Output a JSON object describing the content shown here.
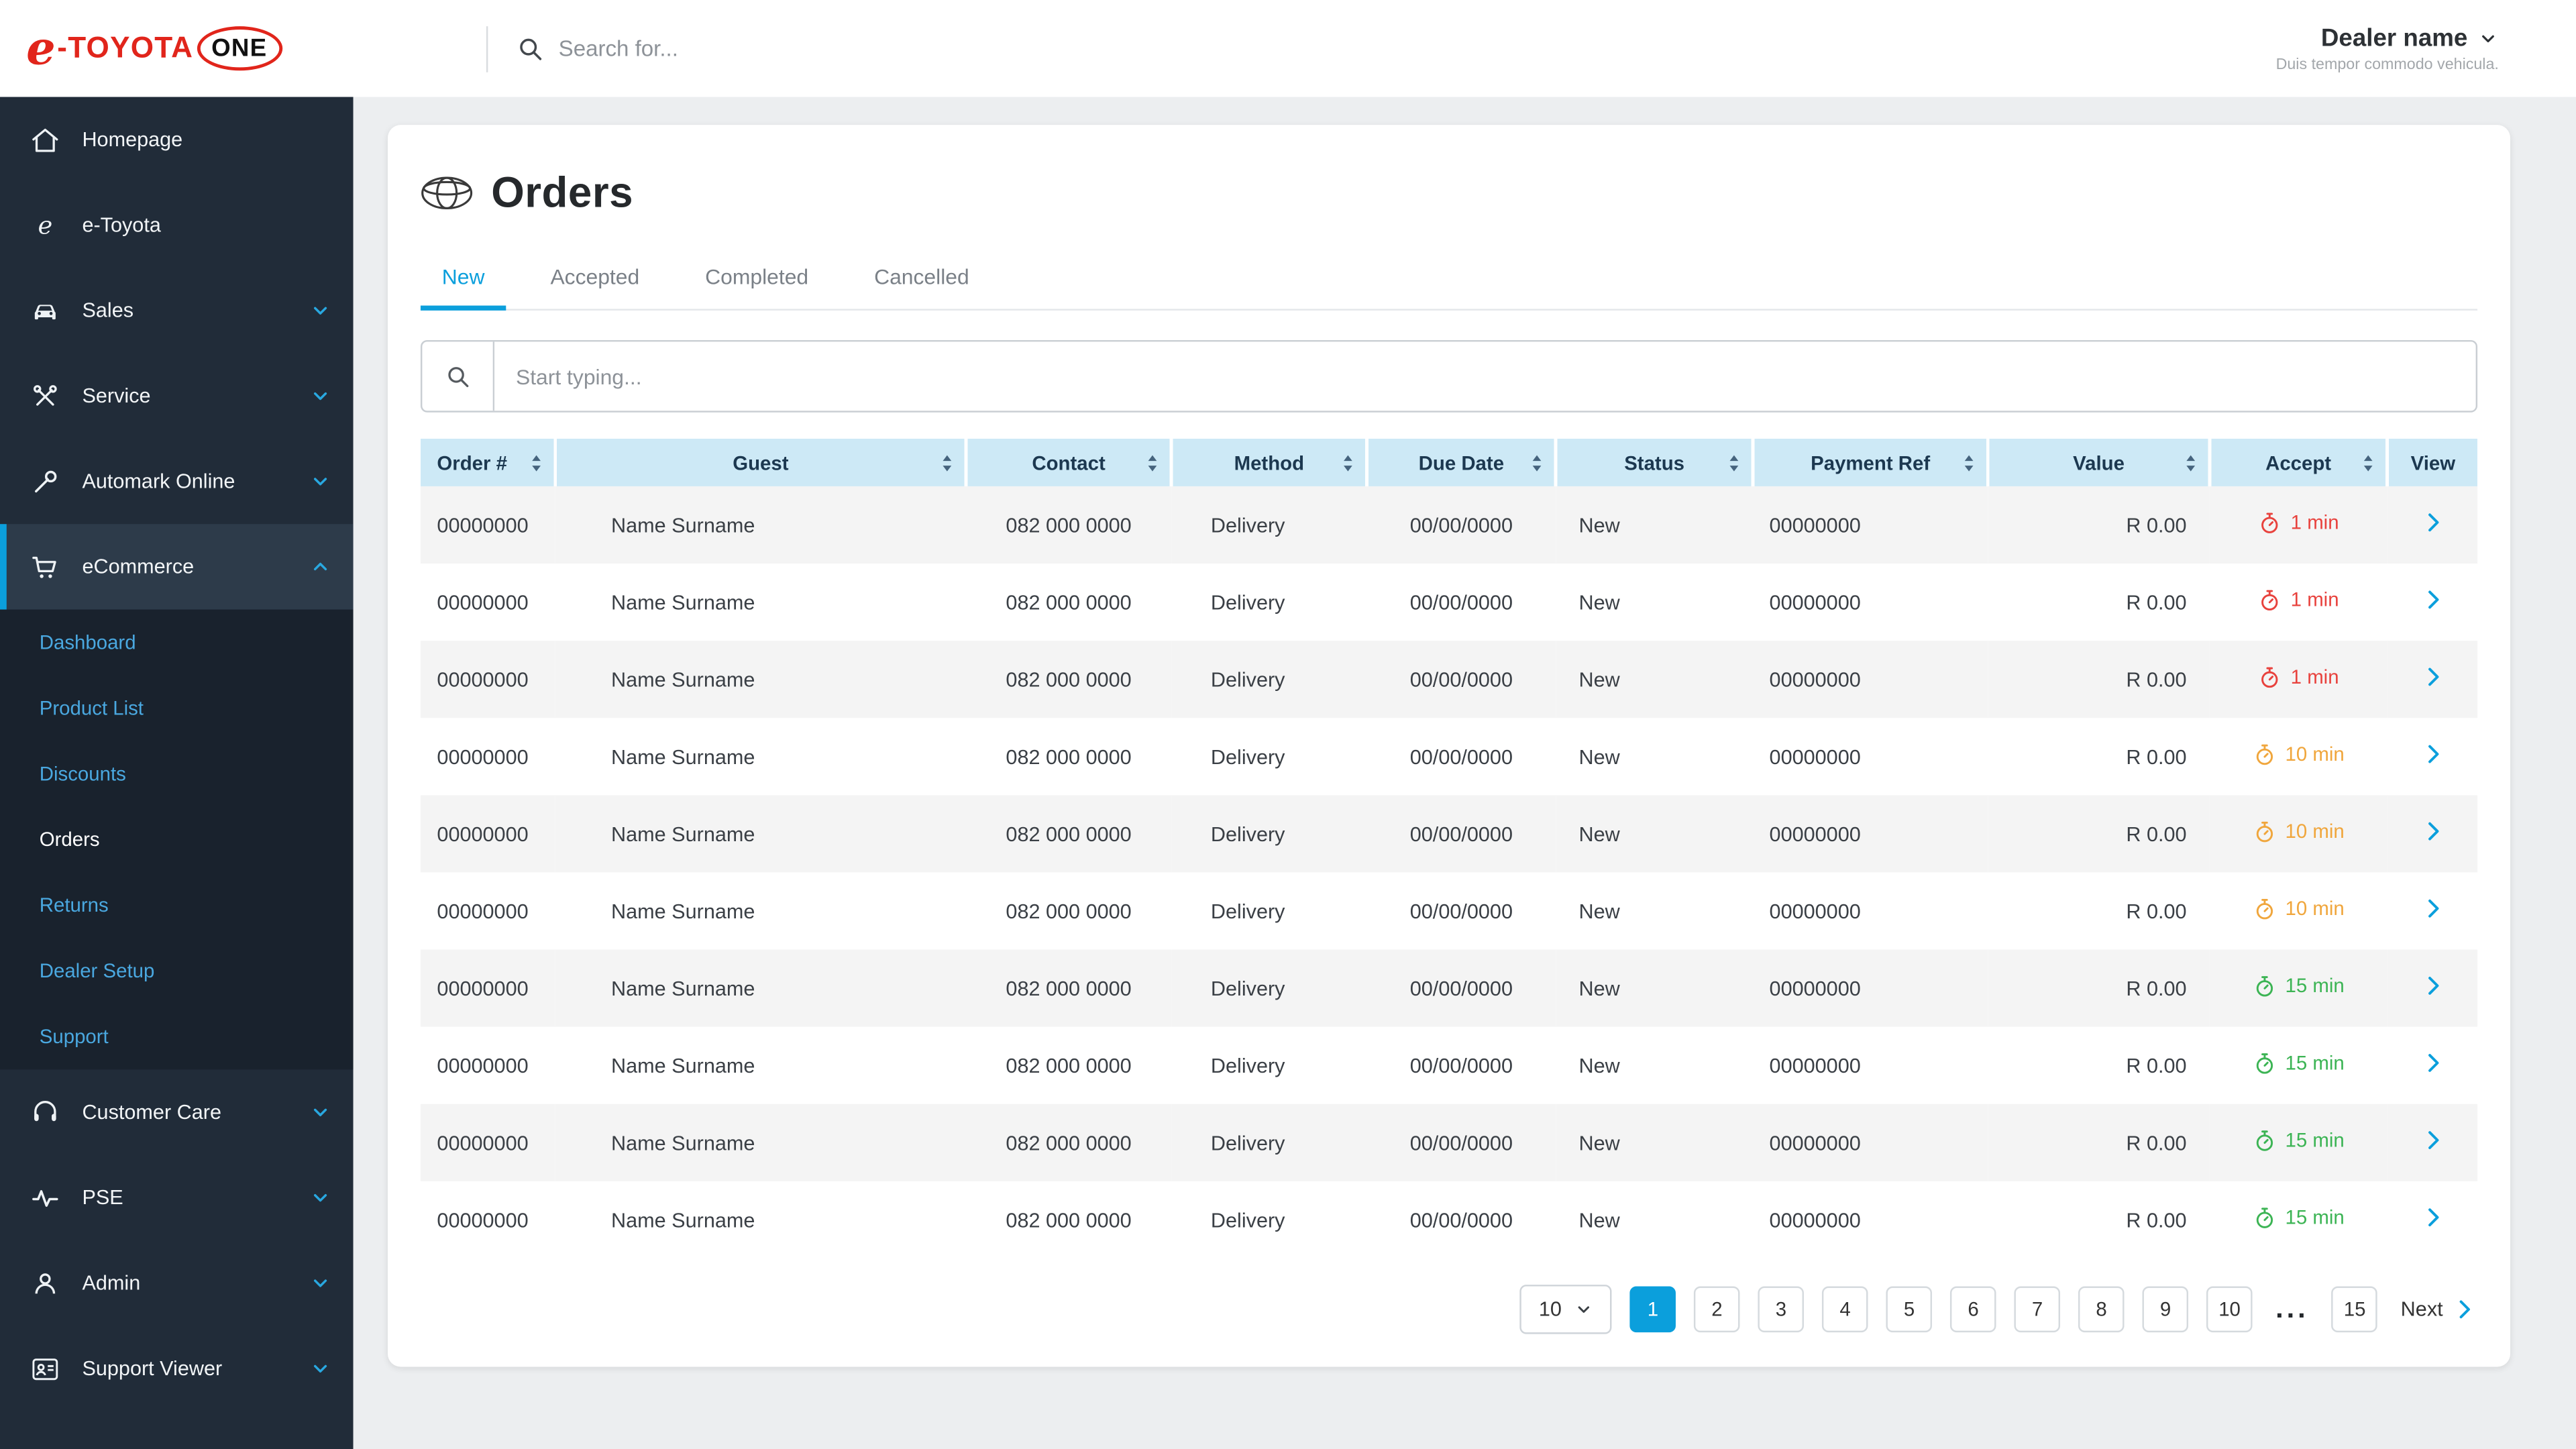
{
  "topbar": {
    "logo": {
      "e": "e",
      "brand": "-TOYOTA",
      "one": "ONE"
    },
    "search": {
      "placeholder": "Search for...",
      "icon": "search-icon"
    },
    "dealer": {
      "name": "Dealer name",
      "subtitle": "Duis tempor commodo vehicula.",
      "icon": "chevron-down-icon"
    }
  },
  "sidebar": {
    "items": [
      {
        "label": "Homepage",
        "icon": "home-icon",
        "expandable": false
      },
      {
        "label": "e-Toyota",
        "icon": "etoyota-icon",
        "expandable": false
      },
      {
        "label": "Sales",
        "icon": "car-icon",
        "expandable": true
      },
      {
        "label": "Service",
        "icon": "tools-icon",
        "expandable": true
      },
      {
        "label": "Automark Online",
        "icon": "wrench-icon",
        "expandable": true
      },
      {
        "label": "eCommerce",
        "icon": "cart-icon",
        "expandable": true,
        "expanded": true,
        "active": true,
        "children": [
          {
            "label": "Dashboard"
          },
          {
            "label": "Product List"
          },
          {
            "label": "Discounts"
          },
          {
            "label": "Orders",
            "active": true
          },
          {
            "label": "Returns"
          },
          {
            "label": "Dealer Setup"
          },
          {
            "label": "Support"
          }
        ]
      },
      {
        "label": "Customer Care",
        "icon": "headset-icon",
        "expandable": true
      },
      {
        "label": "PSE",
        "icon": "pulse-icon",
        "expandable": true
      },
      {
        "label": "Admin",
        "icon": "user-icon",
        "expandable": true
      },
      {
        "label": "Support Viewer",
        "icon": "id-card-icon",
        "expandable": true
      }
    ]
  },
  "page": {
    "title": "Orders",
    "title_icon": "toyota-emblem-icon",
    "tabs": [
      {
        "label": "New",
        "active": true
      },
      {
        "label": "Accepted",
        "active": false
      },
      {
        "label": "Completed",
        "active": false
      },
      {
        "label": "Cancelled",
        "active": false
      }
    ],
    "filter": {
      "placeholder": "Start typing...",
      "icon": "search-icon"
    }
  },
  "table": {
    "columns": [
      {
        "label": "Order #",
        "sortable": true
      },
      {
        "label": "Guest",
        "sortable": true
      },
      {
        "label": "Contact",
        "sortable": true
      },
      {
        "label": "Method",
        "sortable": true
      },
      {
        "label": "Due Date",
        "sortable": true
      },
      {
        "label": "Status",
        "sortable": true
      },
      {
        "label": "Payment Ref",
        "sortable": true
      },
      {
        "label": "Value",
        "sortable": true
      },
      {
        "label": "Accept",
        "sortable": true
      },
      {
        "label": "View",
        "sortable": false
      }
    ],
    "accept_colors": {
      "high": "#e8423d",
      "medium": "#f0a63c",
      "low": "#3cb454"
    },
    "rows": [
      {
        "order": "00000000",
        "guest": "Name Surname",
        "contact": "082 000 0000",
        "method": "Delivery",
        "due_date": "00/00/0000",
        "status": "New",
        "payment_ref": "00000000",
        "value": "R 0.00",
        "accept": {
          "label": "1 min",
          "urgency": "high"
        }
      },
      {
        "order": "00000000",
        "guest": "Name Surname",
        "contact": "082 000 0000",
        "method": "Delivery",
        "due_date": "00/00/0000",
        "status": "New",
        "payment_ref": "00000000",
        "value": "R 0.00",
        "accept": {
          "label": "1 min",
          "urgency": "high"
        }
      },
      {
        "order": "00000000",
        "guest": "Name Surname",
        "contact": "082 000 0000",
        "method": "Delivery",
        "due_date": "00/00/0000",
        "status": "New",
        "payment_ref": "00000000",
        "value": "R 0.00",
        "accept": {
          "label": "1 min",
          "urgency": "high"
        }
      },
      {
        "order": "00000000",
        "guest": "Name Surname",
        "contact": "082 000 0000",
        "method": "Delivery",
        "due_date": "00/00/0000",
        "status": "New",
        "payment_ref": "00000000",
        "value": "R 0.00",
        "accept": {
          "label": "10 min",
          "urgency": "medium"
        }
      },
      {
        "order": "00000000",
        "guest": "Name Surname",
        "contact": "082 000 0000",
        "method": "Delivery",
        "due_date": "00/00/0000",
        "status": "New",
        "payment_ref": "00000000",
        "value": "R 0.00",
        "accept": {
          "label": "10 min",
          "urgency": "medium"
        }
      },
      {
        "order": "00000000",
        "guest": "Name Surname",
        "contact": "082 000 0000",
        "method": "Delivery",
        "due_date": "00/00/0000",
        "status": "New",
        "payment_ref": "00000000",
        "value": "R 0.00",
        "accept": {
          "label": "10 min",
          "urgency": "medium"
        }
      },
      {
        "order": "00000000",
        "guest": "Name Surname",
        "contact": "082 000 0000",
        "method": "Delivery",
        "due_date": "00/00/0000",
        "status": "New",
        "payment_ref": "00000000",
        "value": "R 0.00",
        "accept": {
          "label": "15 min",
          "urgency": "low"
        }
      },
      {
        "order": "00000000",
        "guest": "Name Surname",
        "contact": "082 000 0000",
        "method": "Delivery",
        "due_date": "00/00/0000",
        "status": "New",
        "payment_ref": "00000000",
        "value": "R 0.00",
        "accept": {
          "label": "15 min",
          "urgency": "low"
        }
      },
      {
        "order": "00000000",
        "guest": "Name Surname",
        "contact": "082 000 0000",
        "method": "Delivery",
        "due_date": "00/00/0000",
        "status": "New",
        "payment_ref": "00000000",
        "value": "R 0.00",
        "accept": {
          "label": "15 min",
          "urgency": "low"
        }
      },
      {
        "order": "00000000",
        "guest": "Name Surname",
        "contact": "082 000 0000",
        "method": "Delivery",
        "due_date": "00/00/0000",
        "status": "New",
        "payment_ref": "00000000",
        "value": "R 0.00",
        "accept": {
          "label": "15 min",
          "urgency": "low"
        }
      }
    ]
  },
  "pagination": {
    "page_size": "10",
    "pages": [
      "1",
      "2",
      "3",
      "4",
      "5",
      "6",
      "7",
      "8",
      "9",
      "10"
    ],
    "active_page": "1",
    "ellipsis": "...",
    "jump_page": "15",
    "next_label": "Next"
  },
  "colors": {
    "accent_blue": "#0b9fdc",
    "toyota_red": "#e1251b",
    "sidebar_bg": "#212c39",
    "sidebar_active_bg": "#2d3b4a",
    "submenu_bg": "#19222d",
    "link_blue": "#4aa8e0",
    "table_header_bg": "#cde9f6",
    "row_alt_bg": "#f4f4f4",
    "accept_high": "#e8423d",
    "accept_medium": "#f0a63c",
    "accept_low": "#3cb454"
  }
}
